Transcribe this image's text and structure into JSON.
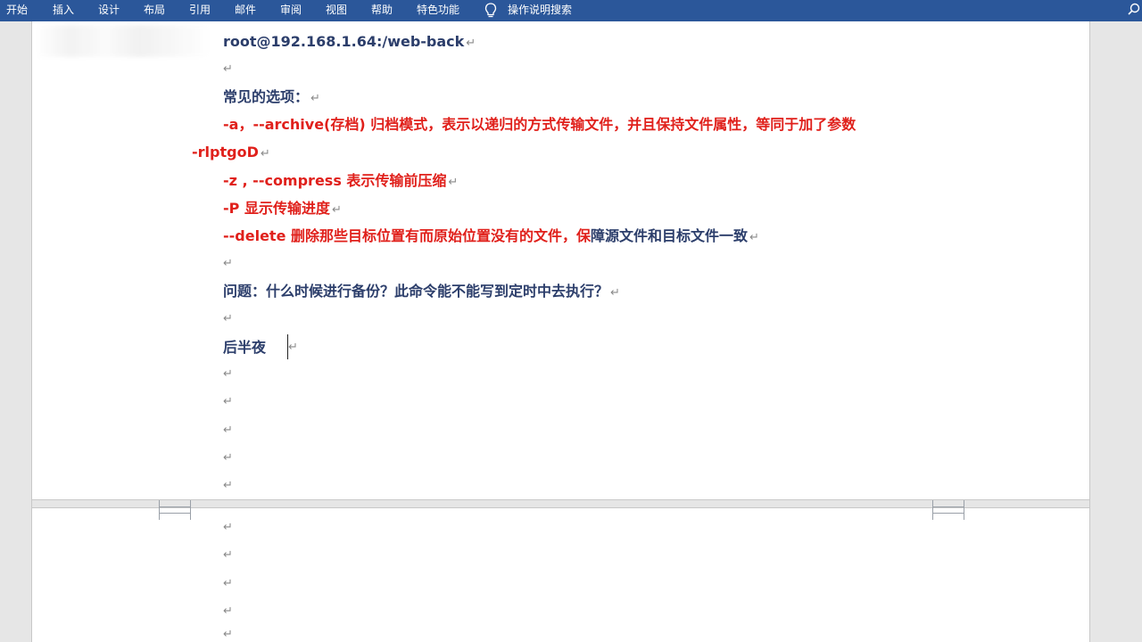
{
  "ribbon": {
    "tabs": [
      {
        "label": "开始"
      },
      {
        "label": "插入"
      },
      {
        "label": "设计"
      },
      {
        "label": "布局"
      },
      {
        "label": "引用"
      },
      {
        "label": "邮件"
      },
      {
        "label": "审阅"
      },
      {
        "label": "视图"
      },
      {
        "label": "帮助"
      },
      {
        "label": "特色功能"
      }
    ],
    "tell_me": "操作说明搜索"
  },
  "document": {
    "line1": "root@192.168.1.64:/web-back",
    "line3": "常见的选项：",
    "opt_a_text": "-a，--archive(存档) 归档模式，表示以递归的方式传输文件，并且保持文件属性，等同于加了参数",
    "opt_a_cont": "-rlptgoD",
    "opt_z_text": "-z , --compress 表示传输前压缩",
    "opt_p_text": "-P 显示传输进度",
    "opt_delete_red": "--delete 删除那些目标位置有而原始位置没有的文件，保",
    "opt_delete_navy": "障源文件和目标文件一致",
    "question": "问题：什么时候进行备份？此命令能不能写到定时中去执行？",
    "answer": "后半夜",
    "paragraph_mark": "↵"
  },
  "colors": {
    "ribbon": "#2b579a",
    "navy_text": "#2c3e6b",
    "red_text": "#e0201b"
  },
  "icons": [
    "lightbulb-icon",
    "search-icon"
  ]
}
